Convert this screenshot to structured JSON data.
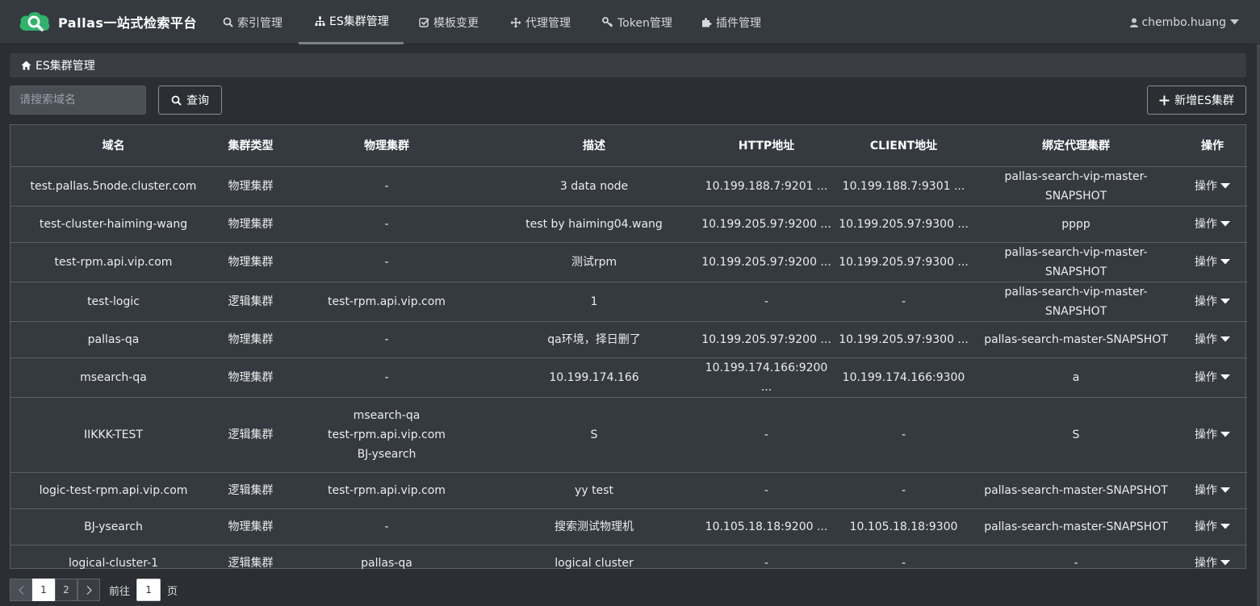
{
  "app": {
    "brand_name": "Pallas一站式检索平台"
  },
  "nav": {
    "items": [
      {
        "label": "索引管理",
        "icon": "search-icon"
      },
      {
        "label": "ES集群管理",
        "icon": "sitemap-icon"
      },
      {
        "label": "模板变更",
        "icon": "check-square-icon"
      },
      {
        "label": "代理管理",
        "icon": "arrows-icon"
      },
      {
        "label": "Token管理",
        "icon": "key-icon"
      },
      {
        "label": "插件管理",
        "icon": "puzzle-icon"
      }
    ],
    "active_index": 1,
    "user": "chembo.huang"
  },
  "breadcrumb": {
    "label": "ES集群管理"
  },
  "search": {
    "placeholder": "请搜索域名",
    "value": "",
    "query_label": "查询"
  },
  "add_button_label": "新增ES集群",
  "table": {
    "headers": [
      "域名",
      "集群类型",
      "物理集群",
      "描述",
      "HTTP地址",
      "CLIENT地址",
      "绑定代理集群",
      "操作"
    ],
    "rows": [
      {
        "domain": "test.pallas.5node.cluster.com",
        "type": "物理集群",
        "physical": "-",
        "desc": "3 data node",
        "http": "10.199.188.7:9201 ...",
        "client": "10.199.188.7:9301 ...",
        "proxy": "pallas-search-vip-master-SNAPSHOT",
        "op": "操作"
      },
      {
        "domain": "test-cluster-haiming-wang",
        "type": "物理集群",
        "physical": "-",
        "desc": "test by haiming04.wang",
        "http": "10.199.205.97:9200 ...",
        "client": "10.199.205.97:9300 ...",
        "proxy": "pppp",
        "op": "操作"
      },
      {
        "domain": "test-rpm.api.vip.com",
        "type": "物理集群",
        "physical": "-",
        "desc": "测试rpm",
        "http": "10.199.205.97:9200 ...",
        "client": "10.199.205.97:9300 ...",
        "proxy": "pallas-search-vip-master-SNAPSHOT",
        "op": "操作"
      },
      {
        "domain": "test-logic",
        "type": "逻辑集群",
        "physical": "test-rpm.api.vip.com",
        "desc": "1",
        "http": "-",
        "client": "-",
        "proxy": "pallas-search-vip-master-SNAPSHOT",
        "op": "操作"
      },
      {
        "domain": "pallas-qa",
        "type": "物理集群",
        "physical": "-",
        "desc": "qa环境，择日删了",
        "http": "10.199.205.97:9200 ...",
        "client": "10.199.205.97:9300 ...",
        "proxy": "pallas-search-master-SNAPSHOT",
        "op": "操作"
      },
      {
        "domain": "msearch-qa",
        "type": "物理集群",
        "physical": "-",
        "desc": "10.199.174.166",
        "http": "10.199.174.166:9200 ...",
        "client": "10.199.174.166:9300",
        "proxy": "a",
        "op": "操作"
      },
      {
        "domain": "IIKKK-TEST",
        "type": "逻辑集群",
        "physical_lines": [
          "msearch-qa",
          "test-rpm.api.vip.com",
          "BJ-ysearch"
        ],
        "desc": "S",
        "http": "-",
        "client": "-",
        "proxy": "S",
        "op": "操作"
      },
      {
        "domain": "logic-test-rpm.api.vip.com",
        "type": "逻辑集群",
        "physical": "test-rpm.api.vip.com",
        "desc": "yy test",
        "http": "-",
        "client": "-",
        "proxy": "pallas-search-master-SNAPSHOT",
        "op": "操作"
      },
      {
        "domain": "BJ-ysearch",
        "type": "物理集群",
        "physical": "-",
        "desc": "搜索测试物理机",
        "http": "10.105.18.18:9200 ...",
        "client": "10.105.18.18:9300",
        "proxy": "pallas-search-master-SNAPSHOT",
        "op": "操作"
      },
      {
        "domain": "logical-cluster-1",
        "type": "逻辑集群",
        "physical": "pallas-qa",
        "desc": "logical cluster",
        "http": "-",
        "client": "-",
        "proxy": "-",
        "op": "操作"
      }
    ]
  },
  "pagination": {
    "pages": [
      "1",
      "2"
    ],
    "current": "1",
    "goto_label": "前往",
    "goto_value": "1",
    "page_suffix": "页"
  }
}
